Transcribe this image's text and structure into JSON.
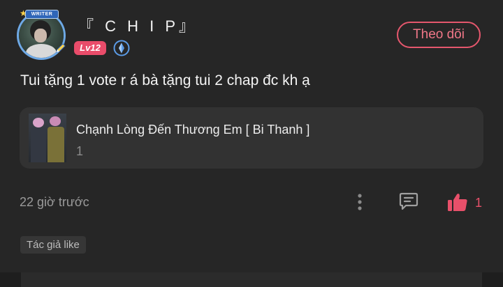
{
  "comment": {
    "author": {
      "name": "『 C H I P』",
      "writer_badge": "WRITER",
      "level": "Lv12"
    },
    "follow_label": "Theo dõi",
    "text": "Tui tặng 1 vote r á bà tặng tui 2 chap đc kh ạ",
    "story": {
      "title": "Chạnh Lòng Đến Thương Em [ Bi Thanh ]",
      "chapter": "1"
    },
    "time": "22 giờ trước",
    "likes": "1",
    "author_like_label": "Tác giả like"
  },
  "icons": {
    "more": "more-vertical-icon",
    "comment": "comment-icon",
    "like": "thumbs-up-icon",
    "verify": "verified-icon"
  },
  "colors": {
    "background": "#262626",
    "accent": "#e8506a",
    "card": "#323232",
    "level_badge": "#e94c6a",
    "verify_blue": "#5b9be6"
  }
}
